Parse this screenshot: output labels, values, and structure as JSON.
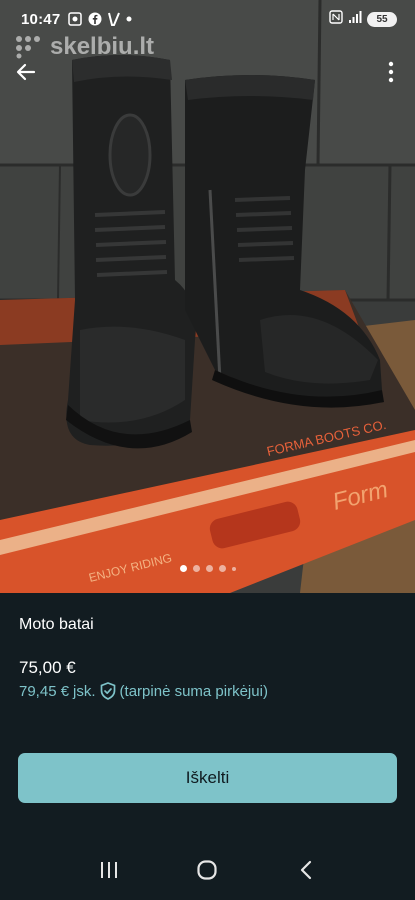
{
  "status_bar": {
    "time": "10:47",
    "battery": "55",
    "icons_left": [
      "screenshot-icon",
      "facebook-icon",
      "vinted-icon",
      "dot-icon"
    ],
    "icons_right": [
      "nfc-icon",
      "signal-icon",
      "battery-icon"
    ]
  },
  "watermark": {
    "text": "skelbiu.lt"
  },
  "listing": {
    "title": "Moto batai",
    "price": "75,00 €",
    "protected_price": "79,45 €",
    "protected_suffix": "jsk.",
    "protected_note": "(tarpinė suma pirkėjui)"
  },
  "carousel": {
    "total_dots": 5,
    "active_index": 0
  },
  "actions": {
    "primary_label": "Iškelti"
  },
  "colors": {
    "background": "#121c21",
    "accent": "#7ec3c9",
    "text": "#ffffff"
  },
  "photo_text": {
    "box_brand": "FORMA BOOTS CO.",
    "box_side": "Form",
    "box_slogan": "ENJOY RIDING"
  }
}
